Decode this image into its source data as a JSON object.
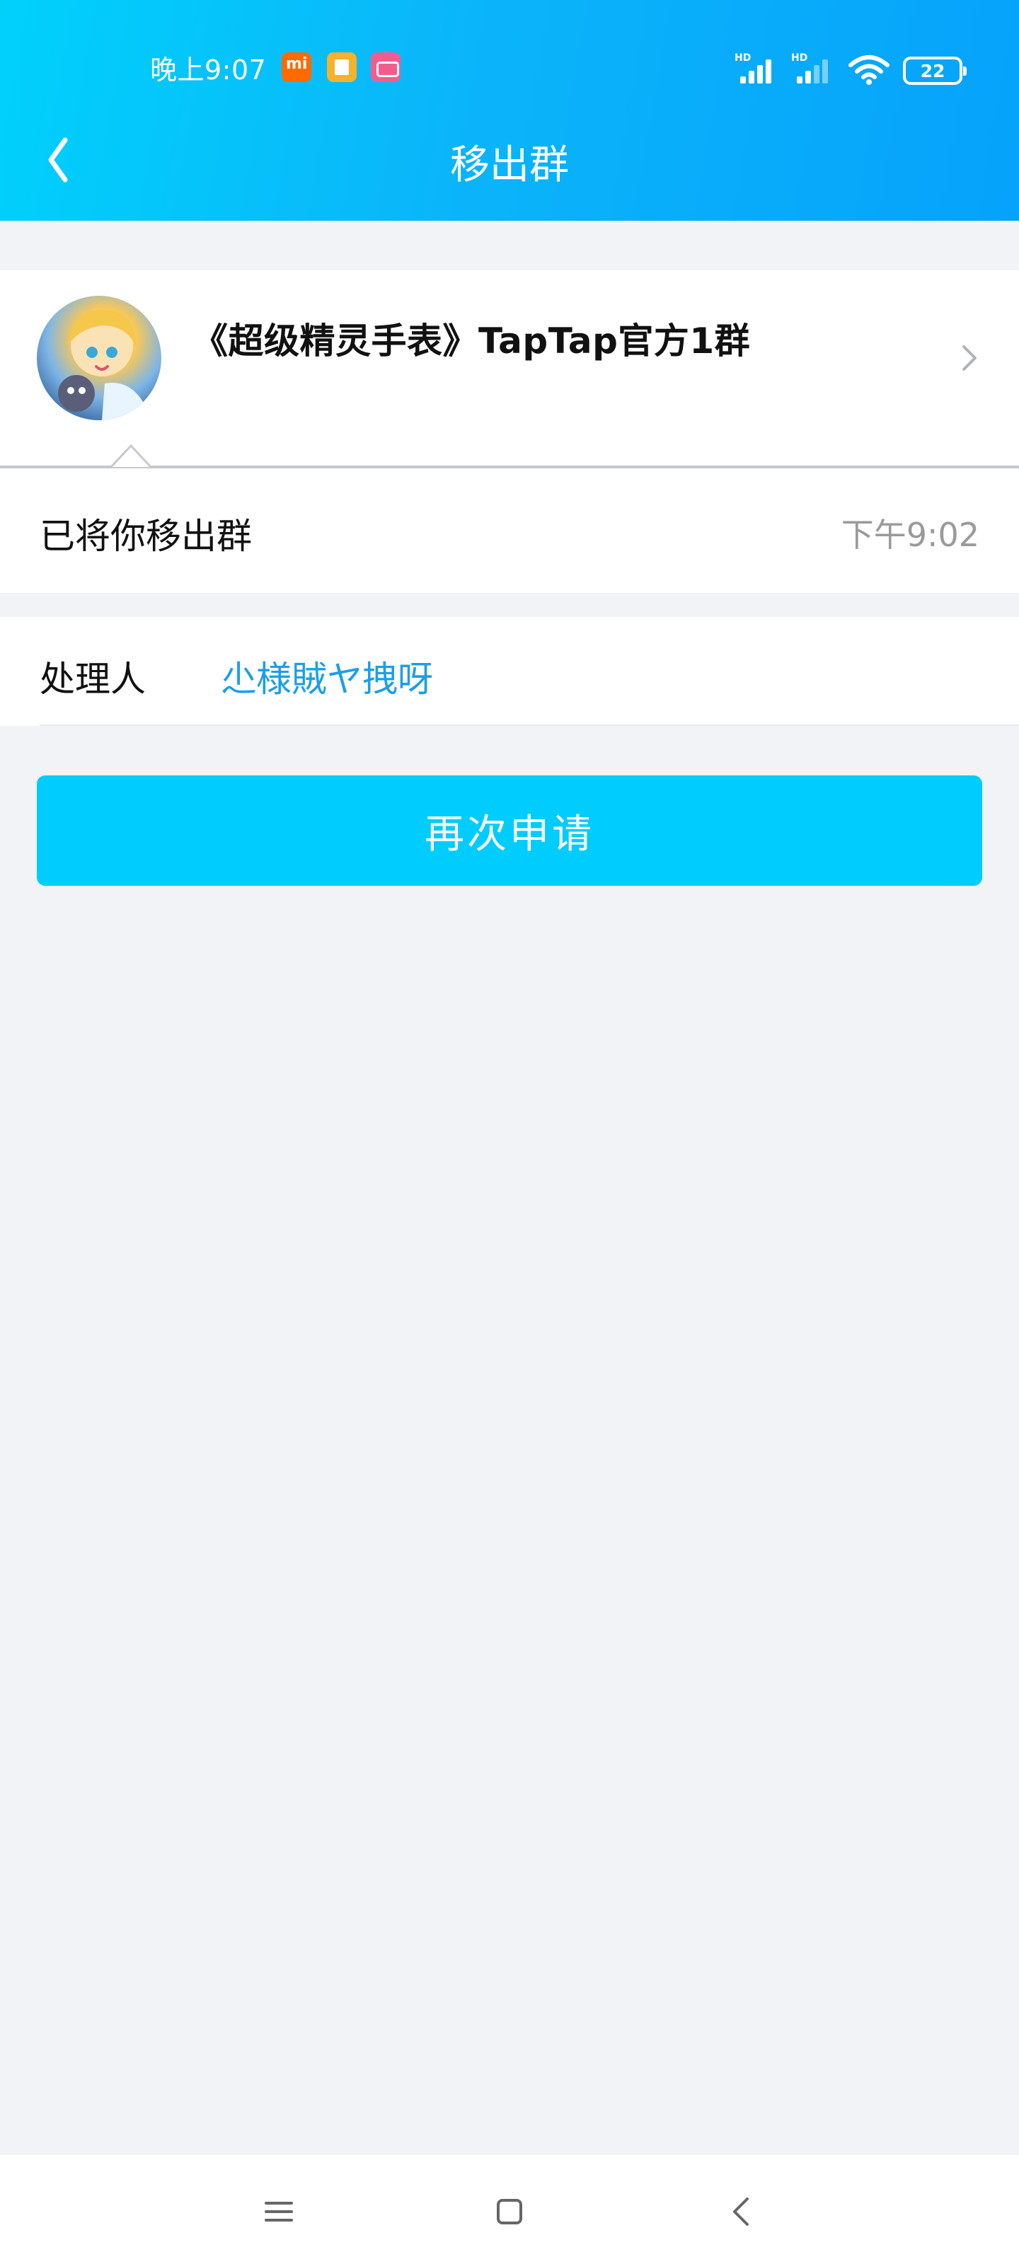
{
  "status_bar": {
    "time": "晚上9:07",
    "battery_level": "22",
    "signal_1_label": "HD",
    "signal_2_label": "HD",
    "notification_icons": [
      "mi-app-icon",
      "document-app-icon",
      "bilibili-app-icon"
    ]
  },
  "header": {
    "title": "移出群",
    "back_icon": "chevron-left-icon"
  },
  "group": {
    "name": "《超级精灵手表》TapTap官方1群"
  },
  "message": {
    "text": "已将你移出群",
    "time": "下午9:02"
  },
  "handler": {
    "label": "处理人",
    "name": "尐様賊ヤ拽呀"
  },
  "actions": {
    "reapply_label": "再次申请"
  },
  "colors": {
    "header_gradient_start": "#00d1fb",
    "header_gradient_end": "#06a2fb",
    "button": "#00ccfd",
    "link": "#1a9fe8",
    "background": "#f2f3f7"
  }
}
